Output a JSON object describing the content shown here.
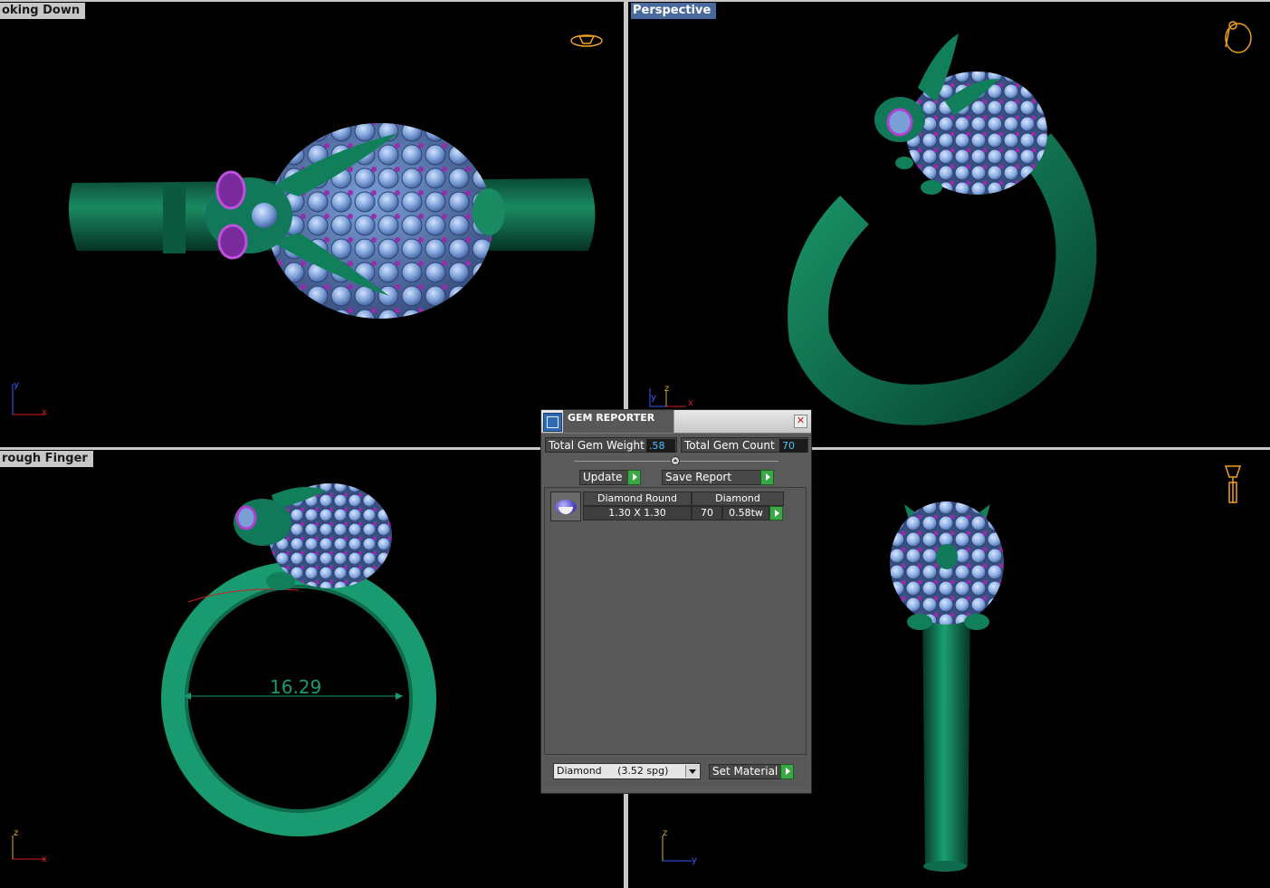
{
  "viewports": {
    "top_left": {
      "label": "oking Down",
      "axis_v": "y",
      "axis_h": "x"
    },
    "top_right": {
      "label": "Perspective",
      "axis_v": "y",
      "axis_v2": "z",
      "axis_h": "x"
    },
    "bottom_left": {
      "label": "rough Finger",
      "axis_v": "z",
      "axis_h": "x",
      "dimension": "16.29"
    },
    "bottom_right": {
      "label": "",
      "axis_v": "z",
      "axis_h": "y"
    }
  },
  "gem_reporter": {
    "title": "GEM REPORTER",
    "total_weight_label": "Total Gem Weight",
    "total_weight_value": ".58",
    "total_count_label": "Total Gem Count",
    "total_count_value": "70",
    "update_label": "Update",
    "save_report_label": "Save Report",
    "columns": {
      "name": "Diamond Round",
      "material": "Diamond"
    },
    "row": {
      "size": "1.30 X 1.30",
      "count": "70",
      "weight": "0.58tw"
    },
    "material_select": "Diamond     (3.52 spg)",
    "set_material_label": "Set Material"
  },
  "colors": {
    "metal": "#0e6b4d",
    "gem": "#7aa0d8",
    "prong": "#8a1f9a",
    "panel": "#5a5a5a",
    "accent": "#4ec2ff"
  }
}
